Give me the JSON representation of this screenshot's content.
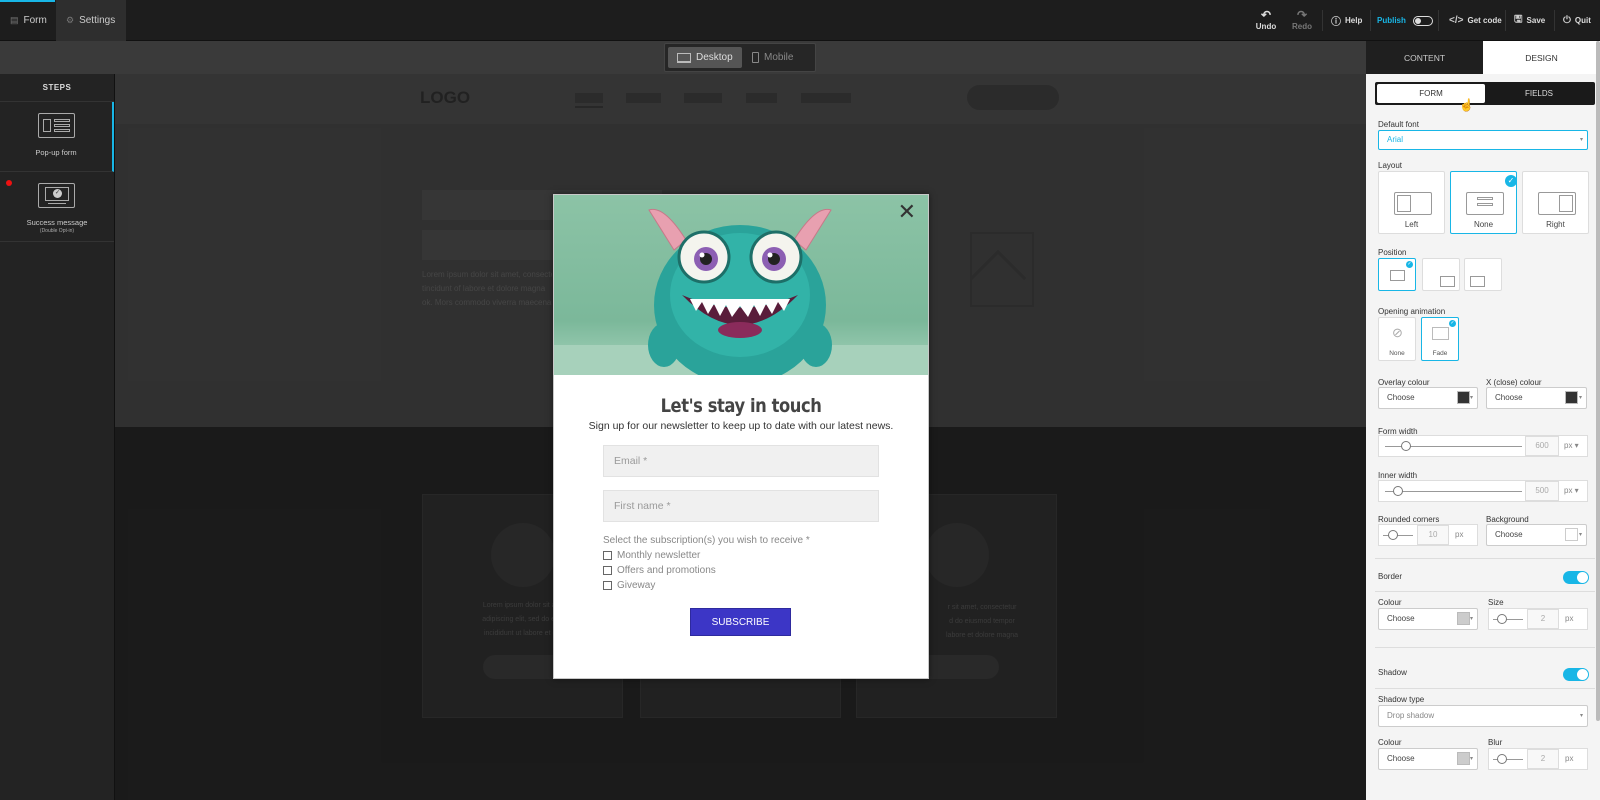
{
  "topbar": {
    "tabs": [
      {
        "label": "Form",
        "icon": "form-icon"
      },
      {
        "label": "Settings",
        "icon": "gear-icon"
      }
    ],
    "undo_label": "Undo",
    "redo_label": "Redo",
    "help_label": "Help",
    "publish_label": "Publish",
    "publish_on": false,
    "getcode_label": "Get code",
    "save_label": "Save",
    "quit_label": "Quit"
  },
  "devices": {
    "desktop": "Desktop",
    "mobile": "Mobile",
    "selected": "Desktop"
  },
  "steps": {
    "title": "STEPS",
    "items": [
      {
        "label": "Pop-up form",
        "sub": ""
      },
      {
        "label": "Success message",
        "sub": "(Double Opt-in)"
      }
    ]
  },
  "mock_site": {
    "logo": "LOGO",
    "lorem_lines": [
      "Lorem ipsum dolor sit amet, consecte-",
      "tincidunt of labore et dolore magna",
      "ok. Mors commodo viverra maecena"
    ],
    "card_left_lines": [
      "Lorem ipsum dolor sit amet,",
      "adipiscing elit, sed do eiusm",
      "incididunt ut labore et dolor"
    ],
    "card_right_lines": [
      "r sit amet, consectetur",
      "d do eiusmod tempor",
      "labore et dolore magna"
    ]
  },
  "popup": {
    "title": "Let's stay in touch",
    "subtitle": "Sign up for our newsletter to keep up to date with our latest news.",
    "email_placeholder": "Email *",
    "firstname_placeholder": "First name *",
    "subscriptions_question": "Select the subscription(s) you wish to receive *",
    "options": [
      "Monthly newsletter",
      "Offers and promotions",
      "Giveway"
    ],
    "button_label": "SUBSCRIBE",
    "button_color": "#3c36c6"
  },
  "panel": {
    "tabs": {
      "content": "CONTENT",
      "design": "DESIGN",
      "active": "DESIGN"
    },
    "subtabs": {
      "form": "FORM",
      "fields": "FIELDS",
      "active": "FORM"
    },
    "default_font_label": "Default font",
    "default_font_value": "Arial",
    "layout_label": "Layout",
    "layout_options": [
      "Left",
      "None",
      "Right"
    ],
    "layout_selected": "None",
    "position_label": "Position",
    "opening_animation_label": "Opening animation",
    "animation_options": [
      "None",
      "Fade"
    ],
    "animation_selected": "Fade",
    "overlay_colour_label": "Overlay colour",
    "overlay_colour_choose": "Choose",
    "overlay_colour_value": "#333333",
    "x_colour_label": "X (close) colour",
    "x_colour_choose": "Choose",
    "x_colour_value": "#333333",
    "form_width_label": "Form width",
    "form_width_value": "600",
    "form_width_unit": "px",
    "inner_width_label": "Inner width",
    "inner_width_value": "500",
    "inner_width_unit": "px",
    "rounded_corners_label": "Rounded corners",
    "rounded_corners_value": "10",
    "rounded_corners_unit": "px",
    "background_label": "Background",
    "background_choose": "Choose",
    "background_value": "#ffffff",
    "border_label": "Border",
    "border_on": true,
    "border_colour_label": "Colour",
    "border_colour_choose": "Choose",
    "border_colour_value": "#cccccc",
    "border_size_label": "Size",
    "border_size_value": "2",
    "border_size_unit": "px",
    "shadow_label": "Shadow",
    "shadow_on": true,
    "shadow_type_label": "Shadow type",
    "shadow_type_value": "Drop shadow",
    "shadow_colour_label": "Colour",
    "shadow_colour_choose": "Choose",
    "shadow_colour_value": "#cccccc",
    "shadow_blur_label": "Blur",
    "shadow_blur_value": "2",
    "shadow_blur_unit": "px",
    "accent_color": "#18b6e6"
  }
}
